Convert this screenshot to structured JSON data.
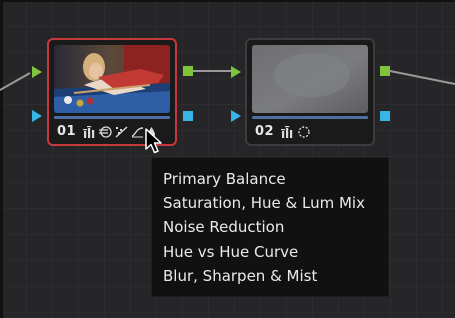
{
  "nodes": [
    {
      "label": "01",
      "selected": true,
      "tools": [
        "primary-balance-icon",
        "saturation-hue-lum-mix-icon",
        "noise-reduction-icon",
        "hue-vs-hue-curve-icon",
        "blur-sharpen-mist-icon"
      ]
    },
    {
      "label": "02",
      "selected": false,
      "tools": [
        "primary-balance-icon",
        "blur-circle-icon"
      ]
    }
  ],
  "tooltip": {
    "items": [
      "Primary Balance",
      "Saturation, Hue & Lum Mix",
      "Noise Reduction",
      "Hue vs Hue Curve",
      "Blur, Sharpen & Mist"
    ]
  },
  "colors": {
    "background": "#262628",
    "selected_border": "#c7383c",
    "rgb_port": "#7fc43b",
    "key_port": "#38b5e6",
    "wire": "#9a9a9a",
    "tooltip_bg": "#111112"
  }
}
